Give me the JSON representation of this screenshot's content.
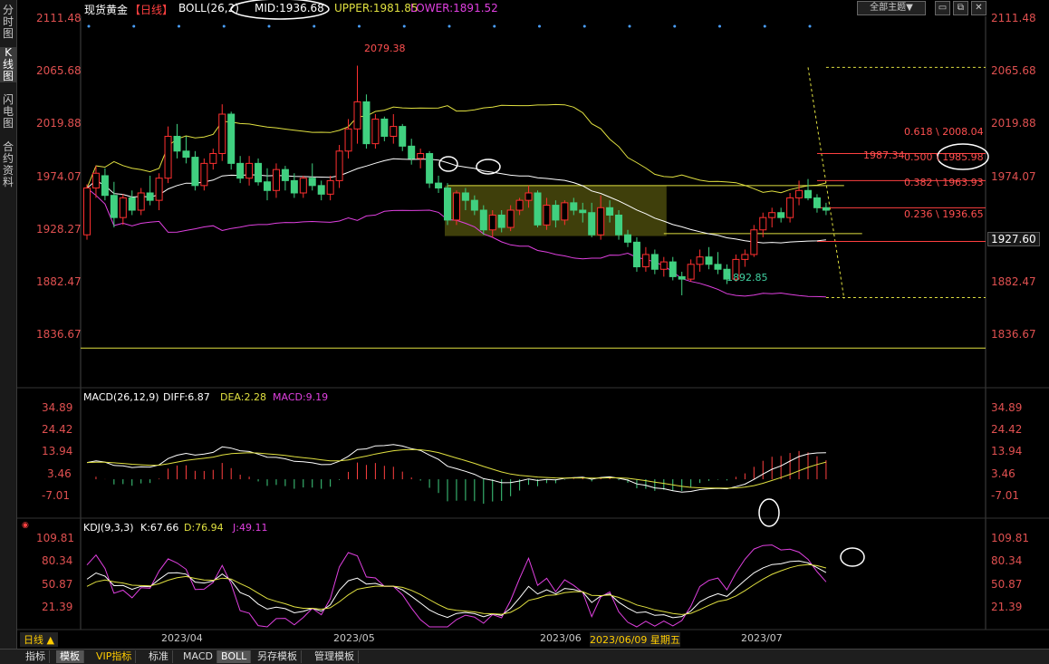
{
  "sidebar": {
    "tabs": [
      {
        "label": "分时图",
        "active": false
      },
      {
        "label": "K线图",
        "active": true
      },
      {
        "label": "闪电图",
        "active": false
      },
      {
        "label": "合约资料",
        "active": false
      }
    ]
  },
  "header": {
    "instrument": "现货黄金",
    "period": "【日线】",
    "boll_label": "BOLL(26,2)",
    "mid": "MID:1936.68",
    "upper": "UPPER:1981.85",
    "lower": "LOWER:1891.52",
    "theme_button": "全部主题▼",
    "colors": {
      "title": "#ffffff",
      "period": "#ff4040",
      "mid": "#ffffff",
      "upper": "#e0e040",
      "lower": "#e040e0"
    }
  },
  "main": {
    "y_labels": [
      "2111.48",
      "2065.68",
      "2019.88",
      "1974.07",
      "1928.27",
      "1882.47",
      "1836.67"
    ],
    "current_price": "1927.60",
    "high_label": "2079.38",
    "low_label": "1892.85",
    "fib": [
      "0.618 \\ 2008.04",
      "0.500 \\ 1985.98",
      "0.382 \\ 1963.93",
      "0.236 \\ 1936.65"
    ],
    "fib_top": "1987.34"
  },
  "macd": {
    "title": "MACD(26,12,9)",
    "diff": "DIFF:6.87",
    "dea": "DEA:2.28",
    "macd": "MACD:9.19",
    "y_labels": [
      "34.89",
      "24.42",
      "13.94",
      "3.46",
      "-7.01"
    ]
  },
  "kdj": {
    "title": "KDJ(9,3,3)",
    "k": "K:67.66",
    "d": "D:76.94",
    "j": "J:49.11",
    "y_labels": [
      "109.81",
      "80.34",
      "50.87",
      "21.39"
    ]
  },
  "x_axis": {
    "period_button": "日线 ▲",
    "dates": [
      "2023/04",
      "2023/05",
      "2023/06",
      "2023/06/09 星期五",
      "2023/07"
    ]
  },
  "bottom_tabs": [
    "指标",
    "模板",
    "VIP指标",
    "标准",
    "MACD",
    "BOLL",
    "另存模板",
    "管理模板"
  ],
  "chart_data": {
    "type": "candlestick",
    "series": [
      {
        "name": "现货黄金 日线",
        "values": [
          {
            "o": 1942,
            "h": 1983,
            "l": 1938,
            "c": 1980
          },
          {
            "o": 1980,
            "h": 1998,
            "l": 1972,
            "c": 1992
          },
          {
            "o": 1990,
            "h": 1996,
            "l": 1970,
            "c": 1974
          },
          {
            "o": 1974,
            "h": 1985,
            "l": 1948,
            "c": 1956
          },
          {
            "o": 1956,
            "h": 1975,
            "l": 1950,
            "c": 1972
          },
          {
            "o": 1972,
            "h": 1978,
            "l": 1958,
            "c": 1962
          },
          {
            "o": 1962,
            "h": 1980,
            "l": 1958,
            "c": 1976
          },
          {
            "o": 1976,
            "h": 1990,
            "l": 1966,
            "c": 1970
          },
          {
            "o": 1970,
            "h": 1992,
            "l": 1962,
            "c": 1988
          },
          {
            "o": 1988,
            "h": 2030,
            "l": 1984,
            "c": 2022
          },
          {
            "o": 2022,
            "h": 2032,
            "l": 2004,
            "c": 2010
          },
          {
            "o": 2010,
            "h": 2022,
            "l": 2000,
            "c": 2005
          },
          {
            "o": 2005,
            "h": 2010,
            "l": 1978,
            "c": 1982
          },
          {
            "o": 1982,
            "h": 2004,
            "l": 1978,
            "c": 2000
          },
          {
            "o": 2000,
            "h": 2012,
            "l": 1995,
            "c": 2008
          },
          {
            "o": 2008,
            "h": 2048,
            "l": 2002,
            "c": 2040
          },
          {
            "o": 2040,
            "h": 2042,
            "l": 1995,
            "c": 2000
          },
          {
            "o": 2000,
            "h": 2006,
            "l": 1984,
            "c": 1988
          },
          {
            "o": 1988,
            "h": 2006,
            "l": 1982,
            "c": 2000
          },
          {
            "o": 2000,
            "h": 2004,
            "l": 1982,
            "c": 1985
          },
          {
            "o": 1985,
            "h": 1996,
            "l": 1970,
            "c": 1978
          },
          {
            "o": 1978,
            "h": 2000,
            "l": 1972,
            "c": 1995
          },
          {
            "o": 1995,
            "h": 1998,
            "l": 1978,
            "c": 1986
          },
          {
            "o": 1986,
            "h": 1992,
            "l": 1972,
            "c": 1976
          },
          {
            "o": 1976,
            "h": 1990,
            "l": 1972,
            "c": 1988
          },
          {
            "o": 1988,
            "h": 2000,
            "l": 1978,
            "c": 1982
          },
          {
            "o": 1982,
            "h": 1986,
            "l": 1970,
            "c": 1975
          },
          {
            "o": 1975,
            "h": 1990,
            "l": 1970,
            "c": 1986
          },
          {
            "o": 1986,
            "h": 2015,
            "l": 1980,
            "c": 2010
          },
          {
            "o": 2010,
            "h": 2036,
            "l": 2004,
            "c": 2028
          },
          {
            "o": 2028,
            "h": 2079.38,
            "l": 2016,
            "c": 2050
          },
          {
            "o": 2050,
            "h": 2056,
            "l": 2012,
            "c": 2016
          },
          {
            "o": 2016,
            "h": 2040,
            "l": 2012,
            "c": 2036
          },
          {
            "o": 2036,
            "h": 2038,
            "l": 2018,
            "c": 2022
          },
          {
            "o": 2022,
            "h": 2040,
            "l": 2016,
            "c": 2030
          },
          {
            "o": 2030,
            "h": 2032,
            "l": 2010,
            "c": 2014
          },
          {
            "o": 2014,
            "h": 2020,
            "l": 1999,
            "c": 2004
          },
          {
            "o": 2004,
            "h": 2012,
            "l": 1996,
            "c": 2008
          },
          {
            "o": 2008,
            "h": 2010,
            "l": 1980,
            "c": 1984
          },
          {
            "o": 1984,
            "h": 1990,
            "l": 1976,
            "c": 1980
          },
          {
            "o": 1980,
            "h": 1984,
            "l": 1950,
            "c": 1954
          },
          {
            "o": 1954,
            "h": 1978,
            "l": 1950,
            "c": 1976
          },
          {
            "o": 1976,
            "h": 1980,
            "l": 1962,
            "c": 1970
          },
          {
            "o": 1970,
            "h": 1974,
            "l": 1958,
            "c": 1962
          },
          {
            "o": 1962,
            "h": 1966,
            "l": 1942,
            "c": 1946
          },
          {
            "o": 1946,
            "h": 1962,
            "l": 1940,
            "c": 1958
          },
          {
            "o": 1958,
            "h": 1962,
            "l": 1944,
            "c": 1948
          },
          {
            "o": 1948,
            "h": 1966,
            "l": 1945,
            "c": 1962
          },
          {
            "o": 1962,
            "h": 1972,
            "l": 1958,
            "c": 1970
          },
          {
            "o": 1970,
            "h": 1982,
            "l": 1964,
            "c": 1976
          },
          {
            "o": 1976,
            "h": 1978,
            "l": 1948,
            "c": 1950
          },
          {
            "o": 1950,
            "h": 1972,
            "l": 1946,
            "c": 1966
          },
          {
            "o": 1966,
            "h": 1970,
            "l": 1948,
            "c": 1954
          },
          {
            "o": 1954,
            "h": 1970,
            "l": 1950,
            "c": 1968
          },
          {
            "o": 1968,
            "h": 1972,
            "l": 1958,
            "c": 1962
          },
          {
            "o": 1962,
            "h": 1968,
            "l": 1952,
            "c": 1960
          },
          {
            "o": 1960,
            "h": 1968,
            "l": 1940,
            "c": 1942
          },
          {
            "o": 1942,
            "h": 1974,
            "l": 1938,
            "c": 1964
          },
          {
            "o": 1964,
            "h": 1970,
            "l": 1952,
            "c": 1958
          },
          {
            "o": 1958,
            "h": 1962,
            "l": 1938,
            "c": 1942
          },
          {
            "o": 1942,
            "h": 1946,
            "l": 1932,
            "c": 1936
          },
          {
            "o": 1936,
            "h": 1940,
            "l": 1912,
            "c": 1916
          },
          {
            "o": 1916,
            "h": 1932,
            "l": 1912,
            "c": 1926
          },
          {
            "o": 1926,
            "h": 1930,
            "l": 1910,
            "c": 1914
          },
          {
            "o": 1914,
            "h": 1924,
            "l": 1908,
            "c": 1920
          },
          {
            "o": 1920,
            "h": 1924,
            "l": 1905,
            "c": 1908
          },
          {
            "o": 1908,
            "h": 1912,
            "l": 1892.85,
            "c": 1906
          },
          {
            "o": 1906,
            "h": 1922,
            "l": 1904,
            "c": 1918
          },
          {
            "o": 1918,
            "h": 1930,
            "l": 1912,
            "c": 1924
          },
          {
            "o": 1924,
            "h": 1932,
            "l": 1914,
            "c": 1918
          },
          {
            "o": 1918,
            "h": 1928,
            "l": 1910,
            "c": 1914
          },
          {
            "o": 1914,
            "h": 1918,
            "l": 1902,
            "c": 1906
          },
          {
            "o": 1906,
            "h": 1926,
            "l": 1904,
            "c": 1922
          },
          {
            "o": 1922,
            "h": 1930,
            "l": 1916,
            "c": 1926
          },
          {
            "o": 1926,
            "h": 1950,
            "l": 1924,
            "c": 1946
          },
          {
            "o": 1946,
            "h": 1960,
            "l": 1940,
            "c": 1956
          },
          {
            "o": 1956,
            "h": 1964,
            "l": 1948,
            "c": 1960
          },
          {
            "o": 1960,
            "h": 1964,
            "l": 1952,
            "c": 1956
          },
          {
            "o": 1956,
            "h": 1976,
            "l": 1952,
            "c": 1972
          },
          {
            "o": 1972,
            "h": 1986,
            "l": 1966,
            "c": 1978
          },
          {
            "o": 1978,
            "h": 1987.34,
            "l": 1970,
            "c": 1972
          },
          {
            "o": 1972,
            "h": 1975,
            "l": 1960,
            "c": 1964
          },
          {
            "o": 1964,
            "h": 1968,
            "l": 1958,
            "c": 1962
          }
        ]
      }
    ],
    "ylim": [
      1820,
      2118
    ],
    "levels": {
      "upper": 1981.85,
      "mid": 1936.68,
      "lower": 1891.52
    },
    "macd_ylim": [
      -20,
      45
    ],
    "kdj_ylim": [
      0,
      125
    ]
  }
}
